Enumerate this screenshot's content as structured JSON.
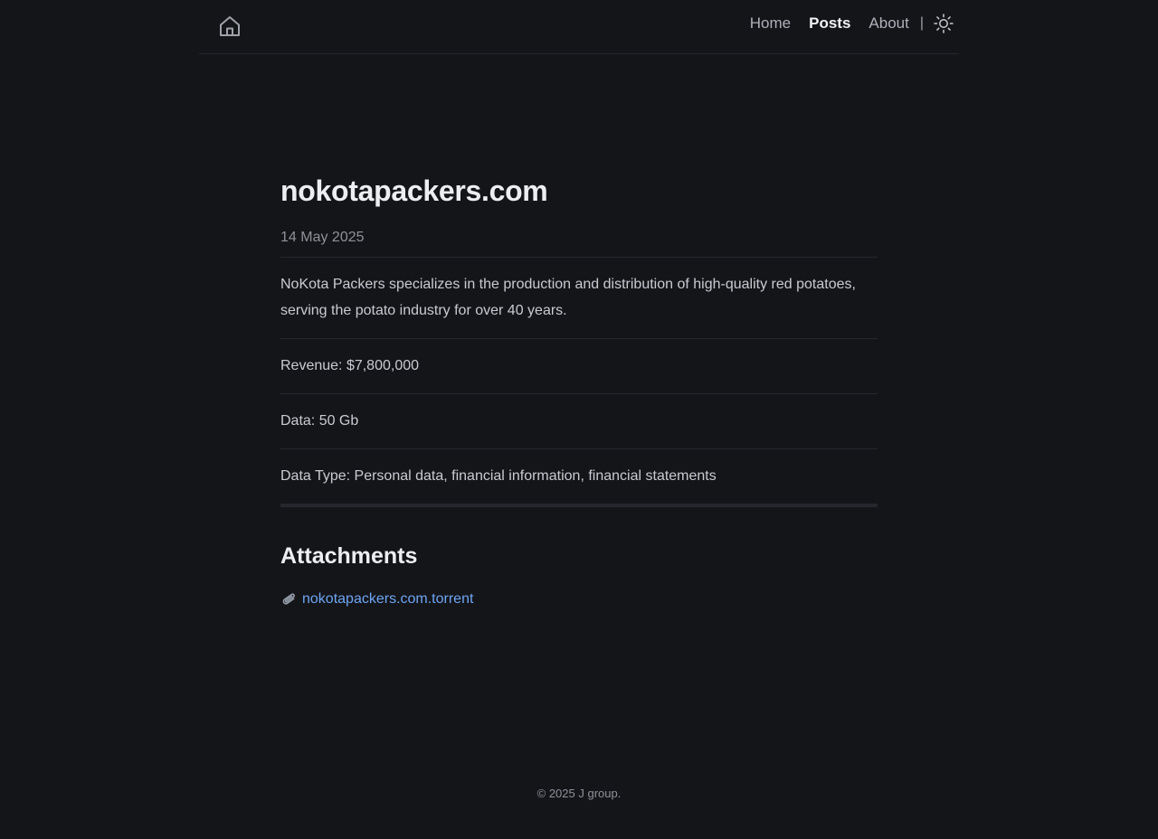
{
  "header": {
    "nav": [
      {
        "label": "Home",
        "active": false
      },
      {
        "label": "Posts",
        "active": true
      },
      {
        "label": "About",
        "active": false
      }
    ],
    "separator": "|",
    "home_icon": "home-icon",
    "theme_icon": "sun-icon"
  },
  "post": {
    "title": "nokotapackers.com",
    "date": "14 May 2025",
    "description": "NoKota Packers specializes in the production and distribution of high-quality red potatoes, serving the potato industry for over 40 years.",
    "revenue": "Revenue: $7,800,000",
    "data": "Data: 50 Gb",
    "data_type": "Data Type: Personal data, financial information, financial statements"
  },
  "attachments": {
    "title": "Attachments",
    "items": [
      {
        "name": "nokotapackers.com.torrent",
        "icon": "paperclip-icon"
      }
    ]
  },
  "footer": {
    "text": "© 2025 J group."
  },
  "colors": {
    "background": "#141519",
    "link": "#6ea5f3",
    "heading": "#eceef1",
    "muted": "#8e9199"
  }
}
